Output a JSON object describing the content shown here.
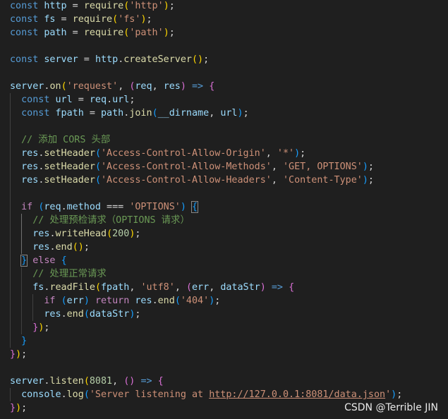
{
  "code_lines": [
    [
      [
        "k",
        "const"
      ],
      [
        "p",
        " "
      ],
      [
        "v",
        "http"
      ],
      [
        "p",
        " = "
      ],
      [
        "f",
        "require"
      ],
      [
        "b1",
        "("
      ],
      [
        "s",
        "'http'"
      ],
      [
        "b1",
        ")"
      ],
      [
        "p",
        ";"
      ]
    ],
    [
      [
        "k",
        "const"
      ],
      [
        "p",
        " "
      ],
      [
        "v",
        "fs"
      ],
      [
        "p",
        " = "
      ],
      [
        "f",
        "require"
      ],
      [
        "b1",
        "("
      ],
      [
        "s",
        "'fs'"
      ],
      [
        "b1",
        ")"
      ],
      [
        "p",
        ";"
      ]
    ],
    [
      [
        "k",
        "const"
      ],
      [
        "p",
        " "
      ],
      [
        "v",
        "path"
      ],
      [
        "p",
        " = "
      ],
      [
        "f",
        "require"
      ],
      [
        "b1",
        "("
      ],
      [
        "s",
        "'path'"
      ],
      [
        "b1",
        ")"
      ],
      [
        "p",
        ";"
      ]
    ],
    [],
    [
      [
        "k",
        "const"
      ],
      [
        "p",
        " "
      ],
      [
        "v",
        "server"
      ],
      [
        "p",
        " = "
      ],
      [
        "v",
        "http"
      ],
      [
        "p",
        "."
      ],
      [
        "f",
        "createServer"
      ],
      [
        "b1",
        "()"
      ],
      [
        "p",
        ";"
      ]
    ],
    [],
    [
      [
        "v",
        "server"
      ],
      [
        "p",
        "."
      ],
      [
        "f",
        "on"
      ],
      [
        "b1",
        "("
      ],
      [
        "s",
        "'request'"
      ],
      [
        "p",
        ", "
      ],
      [
        "b2",
        "("
      ],
      [
        "v",
        "req"
      ],
      [
        "p",
        ", "
      ],
      [
        "v",
        "res"
      ],
      [
        "b2",
        ")"
      ],
      [
        "p",
        " "
      ],
      [
        "k",
        "=>"
      ],
      [
        "p",
        " "
      ],
      [
        "b2",
        "{"
      ]
    ],
    [
      [
        "p",
        "  "
      ],
      [
        "k",
        "const"
      ],
      [
        "p",
        " "
      ],
      [
        "v",
        "url"
      ],
      [
        "p",
        " = "
      ],
      [
        "v",
        "req"
      ],
      [
        "p",
        "."
      ],
      [
        "v",
        "url"
      ],
      [
        "p",
        ";"
      ]
    ],
    [
      [
        "p",
        "  "
      ],
      [
        "k",
        "const"
      ],
      [
        "p",
        " "
      ],
      [
        "v",
        "fpath"
      ],
      [
        "p",
        " = "
      ],
      [
        "v",
        "path"
      ],
      [
        "p",
        "."
      ],
      [
        "f",
        "join"
      ],
      [
        "b3",
        "("
      ],
      [
        "v",
        "__dirname"
      ],
      [
        "p",
        ", "
      ],
      [
        "v",
        "url"
      ],
      [
        "b3",
        ")"
      ],
      [
        "p",
        ";"
      ]
    ],
    [],
    [
      [
        "p",
        "  "
      ],
      [
        "m",
        "// 添加 CORS 头部"
      ]
    ],
    [
      [
        "p",
        "  "
      ],
      [
        "v",
        "res"
      ],
      [
        "p",
        "."
      ],
      [
        "f",
        "setHeader"
      ],
      [
        "b3",
        "("
      ],
      [
        "s",
        "'Access-Control-Allow-Origin'"
      ],
      [
        "p",
        ", "
      ],
      [
        "s",
        "'*'"
      ],
      [
        "b3",
        ")"
      ],
      [
        "p",
        ";"
      ]
    ],
    [
      [
        "p",
        "  "
      ],
      [
        "v",
        "res"
      ],
      [
        "p",
        "."
      ],
      [
        "f",
        "setHeader"
      ],
      [
        "b3",
        "("
      ],
      [
        "s",
        "'Access-Control-Allow-Methods'"
      ],
      [
        "p",
        ", "
      ],
      [
        "s",
        "'GET, OPTIONS'"
      ],
      [
        "b3",
        ")"
      ],
      [
        "p",
        ";"
      ]
    ],
    [
      [
        "p",
        "  "
      ],
      [
        "v",
        "res"
      ],
      [
        "p",
        "."
      ],
      [
        "f",
        "setHeader"
      ],
      [
        "b3",
        "("
      ],
      [
        "s",
        "'Access-Control-Allow-Headers'"
      ],
      [
        "p",
        ", "
      ],
      [
        "s",
        "'Content-Type'"
      ],
      [
        "b3",
        ")"
      ],
      [
        "p",
        ";"
      ]
    ],
    [],
    [
      [
        "p",
        "  "
      ],
      [
        "c",
        "if"
      ],
      [
        "p",
        " "
      ],
      [
        "b3",
        "("
      ],
      [
        "v",
        "req"
      ],
      [
        "p",
        "."
      ],
      [
        "v",
        "method"
      ],
      [
        "p",
        " === "
      ],
      [
        "s",
        "'OPTIONS'"
      ],
      [
        "b3",
        ")"
      ],
      [
        "p",
        " "
      ],
      [
        "b3 match",
        "{"
      ]
    ],
    [
      [
        "p",
        "    "
      ],
      [
        "m",
        "// 处理预检请求（OPTIONS 请求）"
      ]
    ],
    [
      [
        "p",
        "    "
      ],
      [
        "v",
        "res"
      ],
      [
        "p",
        "."
      ],
      [
        "f",
        "writeHead"
      ],
      [
        "b1",
        "("
      ],
      [
        "n",
        "200"
      ],
      [
        "b1",
        ")"
      ],
      [
        "p",
        ";"
      ]
    ],
    [
      [
        "p",
        "    "
      ],
      [
        "v",
        "res"
      ],
      [
        "p",
        "."
      ],
      [
        "f",
        "end"
      ],
      [
        "b1",
        "()"
      ],
      [
        "p",
        ";"
      ]
    ],
    [
      [
        "p",
        "  "
      ],
      [
        "b3 match",
        "}"
      ],
      [
        "p",
        " "
      ],
      [
        "c",
        "else"
      ],
      [
        "p",
        " "
      ],
      [
        "b3",
        "{"
      ]
    ],
    [
      [
        "p",
        "    "
      ],
      [
        "m",
        "// 处理正常请求"
      ]
    ],
    [
      [
        "p",
        "    "
      ],
      [
        "v",
        "fs"
      ],
      [
        "p",
        "."
      ],
      [
        "f",
        "readFile"
      ],
      [
        "b1",
        "("
      ],
      [
        "v",
        "fpath"
      ],
      [
        "p",
        ", "
      ],
      [
        "s",
        "'utf8'"
      ],
      [
        "p",
        ", "
      ],
      [
        "b2",
        "("
      ],
      [
        "v",
        "err"
      ],
      [
        "p",
        ", "
      ],
      [
        "v",
        "dataStr"
      ],
      [
        "b2",
        ")"
      ],
      [
        "p",
        " "
      ],
      [
        "k",
        "=>"
      ],
      [
        "p",
        " "
      ],
      [
        "b2",
        "{"
      ]
    ],
    [
      [
        "p",
        "      "
      ],
      [
        "c",
        "if"
      ],
      [
        "p",
        " "
      ],
      [
        "b3",
        "("
      ],
      [
        "v",
        "err"
      ],
      [
        "b3",
        ")"
      ],
      [
        "p",
        " "
      ],
      [
        "c",
        "return"
      ],
      [
        "p",
        " "
      ],
      [
        "v",
        "res"
      ],
      [
        "p",
        "."
      ],
      [
        "f",
        "end"
      ],
      [
        "b3",
        "("
      ],
      [
        "s",
        "'404'"
      ],
      [
        "b3",
        ")"
      ],
      [
        "p",
        ";"
      ]
    ],
    [
      [
        "p",
        "      "
      ],
      [
        "v",
        "res"
      ],
      [
        "p",
        "."
      ],
      [
        "f",
        "end"
      ],
      [
        "b3",
        "("
      ],
      [
        "v",
        "dataStr"
      ],
      [
        "b3",
        ")"
      ],
      [
        "p",
        ";"
      ]
    ],
    [
      [
        "p",
        "    "
      ],
      [
        "b2",
        "}"
      ],
      [
        "b1",
        ")"
      ],
      [
        "p",
        ";"
      ]
    ],
    [
      [
        "p",
        "  "
      ],
      [
        "b3",
        "}"
      ]
    ],
    [
      [
        "b2",
        "}"
      ],
      [
        "b1",
        ")"
      ],
      [
        "p",
        ";"
      ]
    ],
    [],
    [
      [
        "v",
        "server"
      ],
      [
        "p",
        "."
      ],
      [
        "f",
        "listen"
      ],
      [
        "b1",
        "("
      ],
      [
        "n",
        "8081"
      ],
      [
        "p",
        ", "
      ],
      [
        "b2",
        "()"
      ],
      [
        "p",
        " "
      ],
      [
        "k",
        "=>"
      ],
      [
        "p",
        " "
      ],
      [
        "b2",
        "{"
      ]
    ],
    [
      [
        "p",
        "  "
      ],
      [
        "v",
        "console"
      ],
      [
        "p",
        "."
      ],
      [
        "f",
        "log"
      ],
      [
        "b3",
        "("
      ],
      [
        "s",
        "'Server listening at "
      ],
      [
        "s u",
        "http://127.0.0.1:8081/data.json"
      ],
      [
        "s",
        "'"
      ],
      [
        "b3",
        ")"
      ],
      [
        "p",
        ";"
      ]
    ],
    [
      [
        "b2",
        "}"
      ],
      [
        "b1",
        ")"
      ],
      [
        "p",
        ";"
      ]
    ]
  ],
  "watermark": "CSDN @Terrible JIN"
}
